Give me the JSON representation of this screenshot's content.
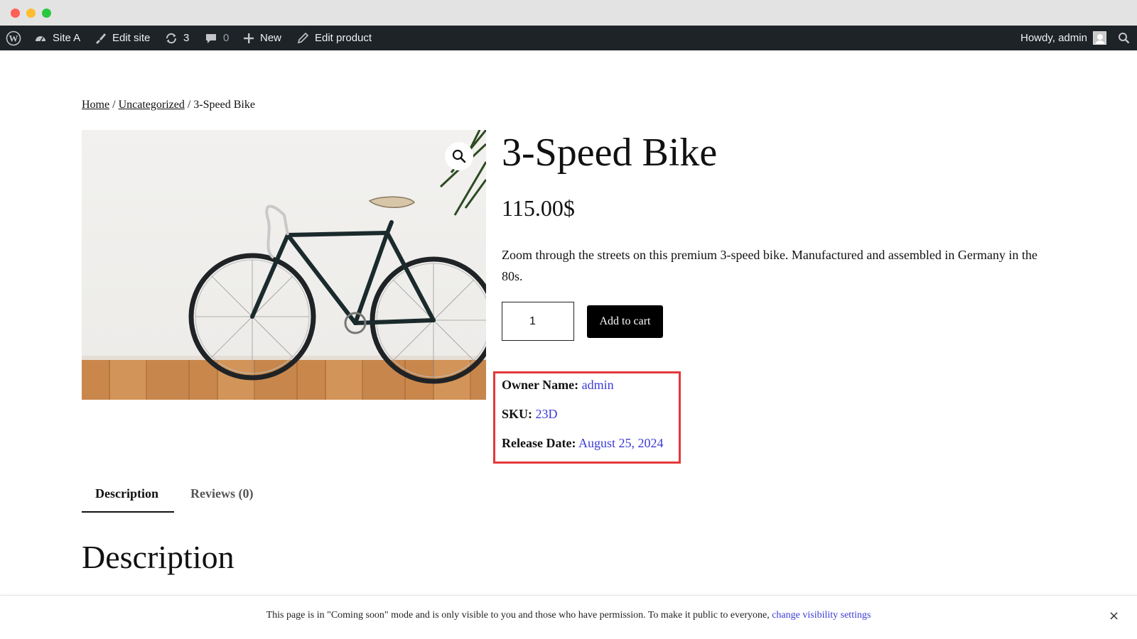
{
  "adminbar": {
    "site_name": "Site A",
    "edit_site": "Edit site",
    "updates_count": "3",
    "comments_count": "0",
    "new_label": "New",
    "edit_product": "Edit product",
    "howdy": "Howdy, admin"
  },
  "breadcrumb": {
    "home": "Home",
    "separator": "/",
    "category": "Uncategorized",
    "current": "3-Speed Bike"
  },
  "product": {
    "title": "3-Speed Bike",
    "price": "115.00$",
    "short_description": "Zoom through the streets on this premium 3-speed bike. Manufactured and assembled in Germany in the 80s.",
    "quantity": "1",
    "add_to_cart_label": "Add to cart"
  },
  "meta": {
    "owner_label": "Owner Name:",
    "owner_value": "admin",
    "sku_label": "SKU:",
    "sku_value": "23D",
    "release_label": "Release Date:",
    "release_value": "August 25, 2024",
    "highlight_color": "#e5383b"
  },
  "tabs": [
    {
      "label": "Description",
      "active": true
    },
    {
      "label": "Reviews (0)",
      "active": false
    }
  ],
  "description_heading": "Description",
  "notice": {
    "text": "This page is in \"Coming soon\" mode and is only visible to you and those who have permission. To make it public to everyone,",
    "link": "change visibility settings",
    "close": "×"
  },
  "colors": {
    "adminbar_bg": "#1d2327",
    "link": "#3b3bd8",
    "button_bg": "#000000"
  }
}
